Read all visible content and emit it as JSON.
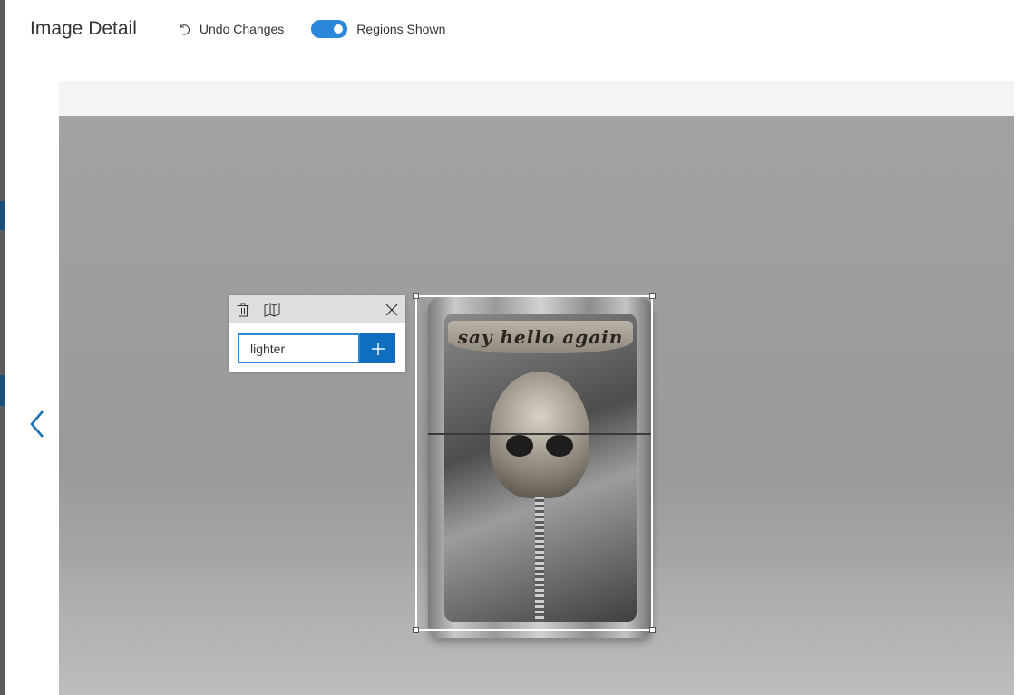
{
  "header": {
    "title": "Image Detail",
    "undo_label": "Undo Changes",
    "regions_toggle_label": "Regions Shown",
    "regions_toggle_on": true
  },
  "image": {
    "engraving_text": "say hello again"
  },
  "tag_popup": {
    "input_value": "lighter",
    "delete_icon": "trash-icon",
    "split_icon": "split-view-icon",
    "close_icon": "close-icon",
    "add_icon": "plus-icon"
  },
  "navigation": {
    "prev_icon": "chevron-left-icon"
  },
  "colors": {
    "accent": "#2b88d8",
    "add_button": "#106ebe",
    "strip": "#f4f4f4"
  }
}
